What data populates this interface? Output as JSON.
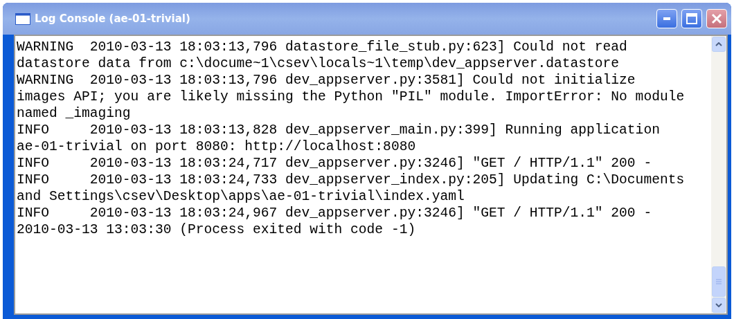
{
  "window": {
    "title": "Log Console (ae-01-trivial)"
  },
  "log_lines": [
    "WARNING  2010-03-13 18:03:13,796 datastore_file_stub.py:623] Could not read",
    "datastore data from c:\\docume~1\\csev\\locals~1\\temp\\dev_appserver.datastore",
    "WARNING  2010-03-13 18:03:13,796 dev_appserver.py:3581] Could not initialize",
    "images API; you are likely missing the Python \"PIL\" module. ImportError: No module",
    "named _imaging",
    "INFO     2010-03-13 18:03:13,828 dev_appserver_main.py:399] Running application",
    "ae-01-trivial on port 8080: http://localhost:8080",
    "INFO     2010-03-13 18:03:24,717 dev_appserver.py:3246] \"GET / HTTP/1.1\" 200 -",
    "INFO     2010-03-13 18:03:24,733 dev_appserver_index.py:205] Updating C:\\Documents",
    "and Settings\\csev\\Desktop\\apps\\ae-01-trivial\\index.yaml",
    "INFO     2010-03-13 18:03:24,967 dev_appserver.py:3246] \"GET / HTTP/1.1\" 200 -",
    "2010-03-13 13:03:30 (Process exited with code -1)"
  ]
}
